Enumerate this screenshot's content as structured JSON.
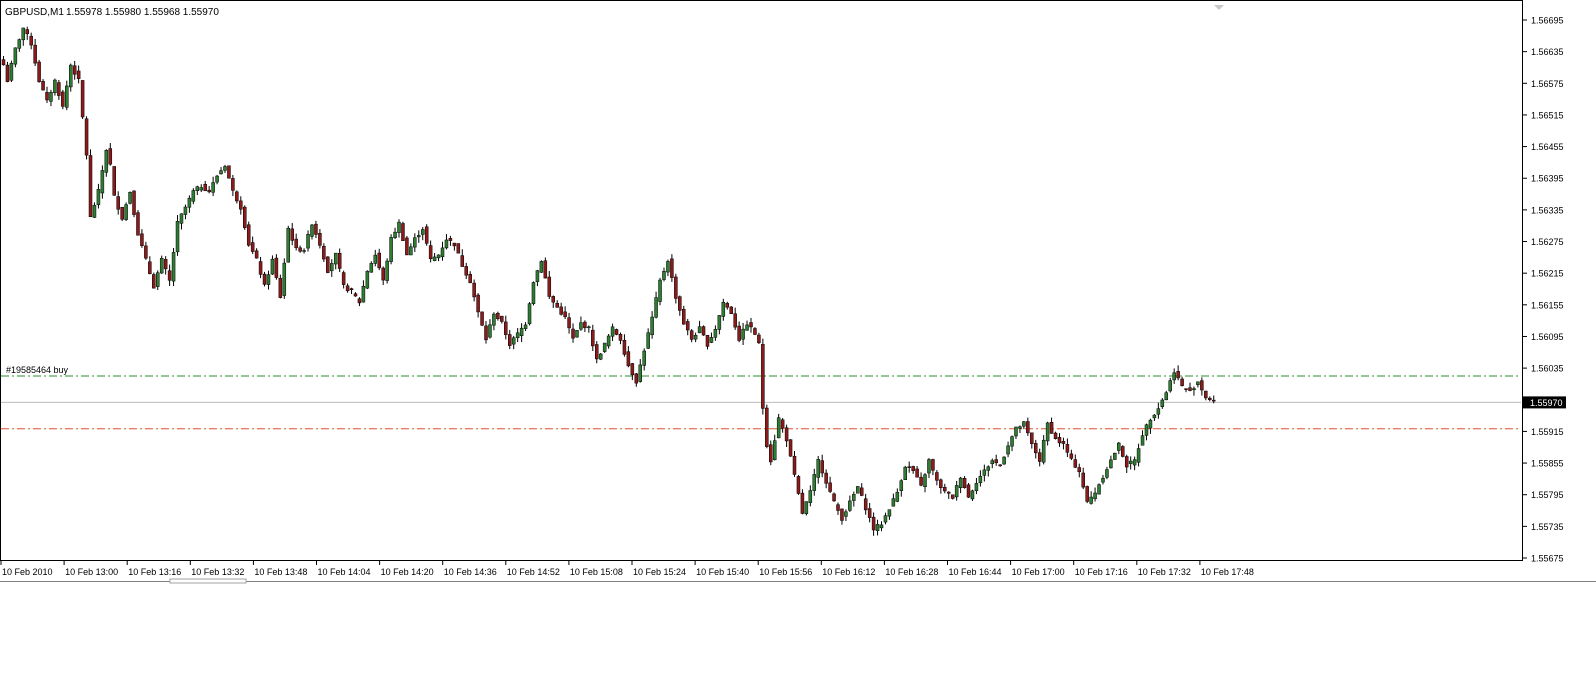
{
  "header": {
    "symbol": "GBPUSD,M1",
    "ohlc": "1.55978 1.55980 1.55968 1.55970"
  },
  "order_line": {
    "label": "#19585464 buy"
  },
  "colors": {
    "bull": "#2e7d32",
    "bear": "#8b1a1a",
    "wick": "#000000",
    "order_line": "#2e8b2e",
    "stop_line": "#e0502a",
    "bid_line": "#bbbbbb",
    "grid_frame": "#000000"
  },
  "chart_data": {
    "type": "candlestick",
    "symbol": "GBPUSD",
    "timeframe": "M1",
    "y_ticks": [
      "1.56695",
      "1.56635",
      "1.56575",
      "1.56515",
      "1.56455",
      "1.56395",
      "1.56335",
      "1.56275",
      "1.56215",
      "1.56155",
      "1.56095",
      "1.56035",
      "1.55915",
      "1.55855",
      "1.55795",
      "1.55735",
      "1.55675"
    ],
    "y_tick_values": [
      1.56695,
      1.56635,
      1.56575,
      1.56515,
      1.56455,
      1.56395,
      1.56335,
      1.56275,
      1.56215,
      1.56155,
      1.56095,
      1.56035,
      1.55915,
      1.55855,
      1.55795,
      1.55735,
      1.55675
    ],
    "ylim": [
      1.5566,
      1.5672
    ],
    "x_ticks": [
      "10 Feb 2010",
      "10 Feb 13:00",
      "10 Feb 13:16",
      "10 Feb 13:32",
      "10 Feb 13:48",
      "10 Feb 14:04",
      "10 Feb 14:20",
      "10 Feb 14:36",
      "10 Feb 14:52",
      "10 Feb 15:08",
      "10 Feb 15:24",
      "10 Feb 15:40",
      "10 Feb 15:56",
      "10 Feb 16:12",
      "10 Feb 16:28",
      "10 Feb 16:44",
      "10 Feb 17:00",
      "10 Feb 17:16",
      "10 Feb 17:32",
      "10 Feb 17:48"
    ],
    "current_price": "1.55970",
    "current_price_value": 1.5597,
    "order_price": 1.5602,
    "stop_price": 1.5592,
    "close_keypoints": [
      [
        0,
        1.5661
      ],
      [
        1,
        1.5658
      ],
      [
        3,
        1.5664
      ],
      [
        5,
        1.5668
      ],
      [
        7,
        1.5665
      ],
      [
        9,
        1.5658
      ],
      [
        11,
        1.5654
      ],
      [
        13,
        1.5658
      ],
      [
        15,
        1.5653
      ],
      [
        17,
        1.5661
      ],
      [
        19,
        1.5658
      ],
      [
        21,
        1.5644
      ],
      [
        22,
        1.5632
      ],
      [
        24,
        1.5637
      ],
      [
        26,
        1.5645
      ],
      [
        27,
        1.5642
      ],
      [
        28,
        1.5636
      ],
      [
        30,
        1.5632
      ],
      [
        32,
        1.5637
      ],
      [
        34,
        1.5629
      ],
      [
        36,
        1.5624
      ],
      [
        38,
        1.5619
      ],
      [
        40,
        1.5624
      ],
      [
        42,
        1.562
      ],
      [
        44,
        1.5631
      ],
      [
        46,
        1.5634
      ],
      [
        48,
        1.5637
      ],
      [
        50,
        1.5638
      ],
      [
        52,
        1.5637
      ],
      [
        54,
        1.564
      ],
      [
        56,
        1.5642
      ],
      [
        58,
        1.5637
      ],
      [
        60,
        1.5634
      ],
      [
        62,
        1.5627
      ],
      [
        64,
        1.5624
      ],
      [
        66,
        1.5619
      ],
      [
        68,
        1.5624
      ],
      [
        70,
        1.5617
      ],
      [
        72,
        1.563
      ],
      [
        74,
        1.5626
      ],
      [
        76,
        1.5626
      ],
      [
        78,
        1.5631
      ],
      [
        80,
        1.5627
      ],
      [
        82,
        1.5622
      ],
      [
        84,
        1.5625
      ],
      [
        86,
        1.5619
      ],
      [
        88,
        1.5618
      ],
      [
        90,
        1.5616
      ],
      [
        92,
        1.5622
      ],
      [
        94,
        1.5625
      ],
      [
        96,
        1.562
      ],
      [
        98,
        1.5628
      ],
      [
        100,
        1.5631
      ],
      [
        102,
        1.5625
      ],
      [
        104,
        1.5628
      ],
      [
        106,
        1.563
      ],
      [
        108,
        1.5624
      ],
      [
        110,
        1.5625
      ],
      [
        112,
        1.5628
      ],
      [
        114,
        1.5627
      ],
      [
        116,
        1.5623
      ],
      [
        118,
        1.562
      ],
      [
        120,
        1.5614
      ],
      [
        122,
        1.5609
      ],
      [
        124,
        1.5614
      ],
      [
        126,
        1.5612
      ],
      [
        128,
        1.5608
      ],
      [
        130,
        1.561
      ],
      [
        132,
        1.5612
      ],
      [
        134,
        1.562
      ],
      [
        136,
        1.5624
      ],
      [
        138,
        1.5617
      ],
      [
        140,
        1.5615
      ],
      [
        142,
        1.5613
      ],
      [
        144,
        1.5609
      ],
      [
        146,
        1.5612
      ],
      [
        148,
        1.5611
      ],
      [
        150,
        1.5605
      ],
      [
        152,
        1.5608
      ],
      [
        154,
        1.5611
      ],
      [
        156,
        1.5609
      ],
      [
        158,
        1.5604
      ],
      [
        160,
        1.5601
      ],
      [
        162,
        1.5607
      ],
      [
        164,
        1.5613
      ],
      [
        166,
        1.562
      ],
      [
        168,
        1.5624
      ],
      [
        170,
        1.5617
      ],
      [
        172,
        1.5612
      ],
      [
        174,
        1.5609
      ],
      [
        176,
        1.5611
      ],
      [
        178,
        1.5608
      ],
      [
        180,
        1.5611
      ],
      [
        182,
        1.5616
      ],
      [
        184,
        1.5614
      ],
      [
        186,
        1.5609
      ],
      [
        188,
        1.5612
      ],
      [
        190,
        1.561
      ],
      [
        191,
        1.5608
      ],
      [
        192,
        1.5596
      ],
      [
        193,
        1.5589
      ],
      [
        194,
        1.5586
      ],
      [
        196,
        1.5594
      ],
      [
        198,
        1.559
      ],
      [
        200,
        1.5583
      ],
      [
        202,
        1.5576
      ],
      [
        204,
        1.558
      ],
      [
        206,
        1.5586
      ],
      [
        208,
        1.5582
      ],
      [
        210,
        1.5578
      ],
      [
        212,
        1.5575
      ],
      [
        214,
        1.5578
      ],
      [
        216,
        1.5581
      ],
      [
        218,
        1.5577
      ],
      [
        220,
        1.5573
      ],
      [
        222,
        1.5574
      ],
      [
        224,
        1.5577
      ],
      [
        226,
        1.558
      ],
      [
        228,
        1.5585
      ],
      [
        230,
        1.5584
      ],
      [
        232,
        1.5581
      ],
      [
        234,
        1.5586
      ],
      [
        236,
        1.5582
      ],
      [
        238,
        1.558
      ],
      [
        240,
        1.5579
      ],
      [
        242,
        1.5583
      ],
      [
        244,
        1.5579
      ],
      [
        246,
        1.5582
      ],
      [
        248,
        1.5584
      ],
      [
        250,
        1.5586
      ],
      [
        252,
        1.5585
      ],
      [
        254,
        1.5589
      ],
      [
        256,
        1.5592
      ],
      [
        258,
        1.5593
      ],
      [
        260,
        1.5589
      ],
      [
        262,
        1.5586
      ],
      [
        264,
        1.5593
      ],
      [
        266,
        1.559
      ],
      [
        268,
        1.5589
      ],
      [
        270,
        1.5586
      ],
      [
        272,
        1.5584
      ],
      [
        274,
        1.5578
      ],
      [
        276,
        1.558
      ],
      [
        278,
        1.5583
      ],
      [
        280,
        1.5586
      ],
      [
        282,
        1.5589
      ],
      [
        284,
        1.5585
      ],
      [
        286,
        1.5586
      ],
      [
        288,
        1.5591
      ],
      [
        290,
        1.5594
      ],
      [
        292,
        1.5596
      ],
      [
        294,
        1.5599
      ],
      [
        296,
        1.5603
      ],
      [
        298,
        1.56
      ],
      [
        300,
        1.5599
      ],
      [
        302,
        1.5601
      ],
      [
        304,
        1.5598
      ],
      [
        306,
        1.5597
      ]
    ]
  }
}
